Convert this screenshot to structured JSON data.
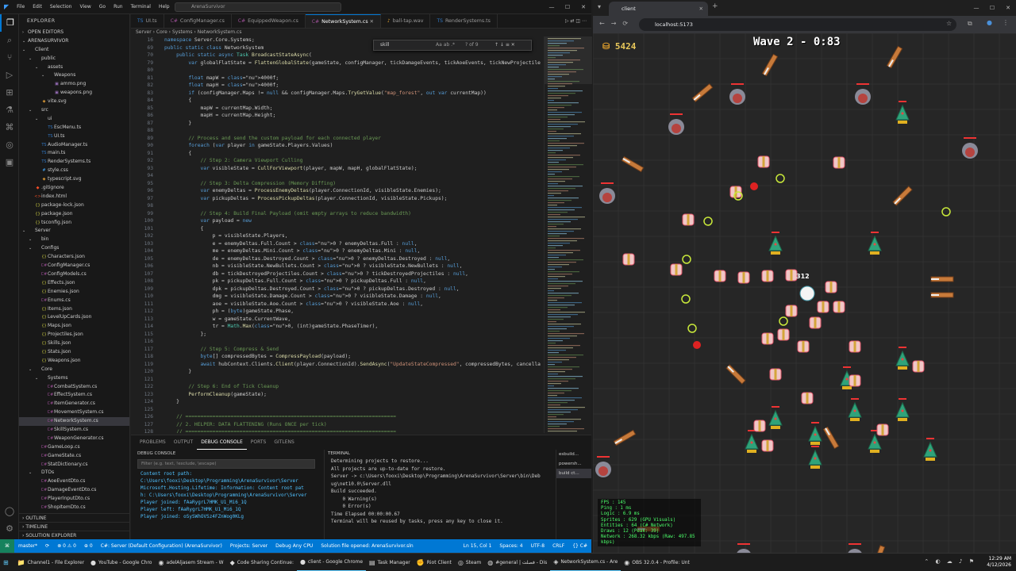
{
  "vscode": {
    "menu": [
      "File",
      "Edit",
      "Selection",
      "View",
      "Go",
      "Run",
      "Terminal",
      "Help"
    ],
    "command_center": "ArenaSurvivor",
    "explorer_title": "EXPLORER",
    "open_editors": "OPEN EDITORS",
    "workspace": "ARENASURVIVOR",
    "tree": [
      {
        "label": "Client",
        "depth": 0,
        "kind": "folder"
      },
      {
        "label": "public",
        "depth": 1,
        "kind": "folder"
      },
      {
        "label": "assets",
        "depth": 2,
        "kind": "folder"
      },
      {
        "label": "Weapons",
        "depth": 3,
        "kind": "folder"
      },
      {
        "label": "ammo.png",
        "depth": 4,
        "kind": "png"
      },
      {
        "label": "weapons.png",
        "depth": 4,
        "kind": "png"
      },
      {
        "label": "vite.svg",
        "depth": 2,
        "kind": "svg"
      },
      {
        "label": "src",
        "depth": 1,
        "kind": "folder"
      },
      {
        "label": "ui",
        "depth": 2,
        "kind": "folder"
      },
      {
        "label": "EscMenu.ts",
        "depth": 3,
        "kind": "ts"
      },
      {
        "label": "UI.ts",
        "depth": 3,
        "kind": "ts"
      },
      {
        "label": "AudioManager.ts",
        "depth": 2,
        "kind": "ts"
      },
      {
        "label": "main.ts",
        "depth": 2,
        "kind": "ts"
      },
      {
        "label": "RenderSystems.ts",
        "depth": 2,
        "kind": "ts"
      },
      {
        "label": "style.css",
        "depth": 2,
        "kind": "css"
      },
      {
        "label": "typescript.svg",
        "depth": 2,
        "kind": "svg"
      },
      {
        "label": ".gitignore",
        "depth": 1,
        "kind": "git"
      },
      {
        "label": "index.html",
        "depth": 1,
        "kind": "html"
      },
      {
        "label": "package-lock.json",
        "depth": 1,
        "kind": "json"
      },
      {
        "label": "package.json",
        "depth": 1,
        "kind": "json"
      },
      {
        "label": "tsconfig.json",
        "depth": 1,
        "kind": "json"
      },
      {
        "label": "Server",
        "depth": 0,
        "kind": "folder"
      },
      {
        "label": "bin",
        "depth": 1,
        "kind": "folder"
      },
      {
        "label": "Configs",
        "depth": 1,
        "kind": "folder"
      },
      {
        "label": "Characters.json",
        "depth": 2,
        "kind": "json"
      },
      {
        "label": "ConfigManager.cs",
        "depth": 2,
        "kind": "cs"
      },
      {
        "label": "ConfigModels.cs",
        "depth": 2,
        "kind": "cs"
      },
      {
        "label": "Effects.json",
        "depth": 2,
        "kind": "json"
      },
      {
        "label": "Enemies.json",
        "depth": 2,
        "kind": "json"
      },
      {
        "label": "Enums.cs",
        "depth": 2,
        "kind": "cs"
      },
      {
        "label": "Items.json",
        "depth": 2,
        "kind": "json"
      },
      {
        "label": "LevelUpCards.json",
        "depth": 2,
        "kind": "json"
      },
      {
        "label": "Maps.json",
        "depth": 2,
        "kind": "json"
      },
      {
        "label": "Projectiles.json",
        "depth": 2,
        "kind": "json"
      },
      {
        "label": "Skills.json",
        "depth": 2,
        "kind": "json"
      },
      {
        "label": "Stats.json",
        "depth": 2,
        "kind": "json"
      },
      {
        "label": "Weapons.json",
        "depth": 2,
        "kind": "json"
      },
      {
        "label": "Core",
        "depth": 1,
        "kind": "folder"
      },
      {
        "label": "Systems",
        "depth": 2,
        "kind": "folder"
      },
      {
        "label": "CombatSystem.cs",
        "depth": 3,
        "kind": "cs"
      },
      {
        "label": "EffectSystem.cs",
        "depth": 3,
        "kind": "cs"
      },
      {
        "label": "ItemGenerator.cs",
        "depth": 3,
        "kind": "cs"
      },
      {
        "label": "MovementSystem.cs",
        "depth": 3,
        "kind": "cs"
      },
      {
        "label": "NetworkSystem.cs",
        "depth": 3,
        "kind": "cs",
        "selected": true
      },
      {
        "label": "SkillSystem.cs",
        "depth": 3,
        "kind": "cs"
      },
      {
        "label": "WeaponGenerator.cs",
        "depth": 3,
        "kind": "cs"
      },
      {
        "label": "GameLoop.cs",
        "depth": 2,
        "kind": "cs"
      },
      {
        "label": "GameState.cs",
        "depth": 2,
        "kind": "cs"
      },
      {
        "label": "StatDictionary.cs",
        "depth": 2,
        "kind": "cs"
      },
      {
        "label": "DTOs",
        "depth": 1,
        "kind": "folder"
      },
      {
        "label": "AoeEventDto.cs",
        "depth": 2,
        "kind": "cs"
      },
      {
        "label": "DamageEventDto.cs",
        "depth": 2,
        "kind": "cs"
      },
      {
        "label": "PlayerInputDto.cs",
        "depth": 2,
        "kind": "cs"
      },
      {
        "label": "ShopItemDto.cs",
        "depth": 2,
        "kind": "cs"
      }
    ],
    "bottom_sections": [
      "OUTLINE",
      "TIMELINE",
      "SOLUTION EXPLORER"
    ],
    "tabs": [
      {
        "label": "UI.ts",
        "icon": "TS"
      },
      {
        "label": "ConfigManager.cs",
        "icon": "C#"
      },
      {
        "label": "EquippedWeapon.cs",
        "icon": "C#"
      },
      {
        "label": "NetworkSystem.cs",
        "icon": "C#",
        "active": true
      },
      {
        "label": "ball-tap.wav",
        "icon": "♪"
      },
      {
        "label": "RenderSystems.ts",
        "icon": "TS"
      }
    ],
    "breadcrumb": "Server › Core › Systems › NetworkSystem.cs",
    "find": {
      "query": "skill",
      "count": "? of 9"
    },
    "code": [
      {
        "n": "16",
        "t": "namespace Server.Core.Systems;"
      },
      {
        "n": "69",
        "t": "public static class NetworkSystem"
      },
      {
        "n": "70",
        "t": "    public static async Task BroadcastStateAsync("
      },
      {
        "n": "79",
        "t": "        var globalFlatState = FlattenGlobalState(gameState, configManager, tickDamageEvents, tickAoeEvents, tickNewProjectile"
      },
      {
        "n": "80",
        "t": ""
      },
      {
        "n": "81",
        "t": "        float mapW = 4000f;"
      },
      {
        "n": "82",
        "t": "        float mapH = 4000f;"
      },
      {
        "n": "83",
        "t": "        if (configManager.Maps != null && configManager.Maps.TryGetValue(\"map_forest\", out var currentMap))"
      },
      {
        "n": "84",
        "t": "        {"
      },
      {
        "n": "85",
        "t": "            mapW = currentMap.Width;"
      },
      {
        "n": "86",
        "t": "            mapH = currentMap.Height;"
      },
      {
        "n": "87",
        "t": "        }"
      },
      {
        "n": "88",
        "t": ""
      },
      {
        "n": "89",
        "t": "        // Process and send the custom payload for each connected player"
      },
      {
        "n": "90",
        "t": "        foreach (var player in gameState.Players.Values)"
      },
      {
        "n": "91",
        "t": "        {"
      },
      {
        "n": "92",
        "t": "            // Step 2: Camera Viewport Culling"
      },
      {
        "n": "93",
        "t": "            var visibleState = CullForViewport(player, mapW, mapH, globalFlatState);"
      },
      {
        "n": "94",
        "t": ""
      },
      {
        "n": "95",
        "t": "            // Step 3: Delta Compression (Memory Diffing)"
      },
      {
        "n": "96",
        "t": "            var enemyDeltas = ProcessEnemyDeltas(player.ConnectionId, visibleState.Enemies);"
      },
      {
        "n": "97",
        "t": "            var pickupDeltas = ProcessPickupDeltas(player.ConnectionId, visibleState.Pickups);"
      },
      {
        "n": "98",
        "t": ""
      },
      {
        "n": "99",
        "t": "            // Step 4: Build Final Payload (omit empty arrays to reduce bandwidth)"
      },
      {
        "n": "100",
        "t": "            var payload = new"
      },
      {
        "n": "101",
        "t": "            {"
      },
      {
        "n": "102",
        "t": "                p = visibleState.Players,"
      },
      {
        "n": "103",
        "t": "                e = enemyDeltas.Full.Count > 0 ? enemyDeltas.Full : null,"
      },
      {
        "n": "104",
        "t": "                me = enemyDeltas.Mini.Count > 0 ? enemyDeltas.Mini : null,"
      },
      {
        "n": "105",
        "t": "                de = enemyDeltas.Destroyed.Count > 0 ? enemyDeltas.Destroyed : null,"
      },
      {
        "n": "106",
        "t": "                nb = visibleState.NewBullets.Count > 0 ? visibleState.NewBullets : null,"
      },
      {
        "n": "107",
        "t": "                db = tickDestroyedProjectiles.Count > 0 ? tickDestroyedProjectiles : null,"
      },
      {
        "n": "108",
        "t": "                pk = pickupDeltas.Full.Count > 0 ? pickupDeltas.Full : null,"
      },
      {
        "n": "109",
        "t": "                dpk = pickupDeltas.Destroyed.Count > 0 ? pickupDeltas.Destroyed : null,"
      },
      {
        "n": "110",
        "t": "                dmg = visibleState.Damage.Count > 0 ? visibleState.Damage : null,"
      },
      {
        "n": "111",
        "t": "                aoe = visibleState.Aoe.Count > 0 ? visibleState.Aoe : null,"
      },
      {
        "n": "112",
        "t": "                ph = (byte)gameState.Phase,"
      },
      {
        "n": "113",
        "t": "                w = gameState.CurrentWave,"
      },
      {
        "n": "114",
        "t": "                tr = Math.Max(0, (int)gameState.PhaseTimer),"
      },
      {
        "n": "115",
        "t": "            };"
      },
      {
        "n": "116",
        "t": ""
      },
      {
        "n": "117",
        "t": "            // Step 5: Compress & Send"
      },
      {
        "n": "118",
        "t": "            byte[] compressedBytes = CompressPayload(payload);"
      },
      {
        "n": "119",
        "t": "            await hubContext.Clients.Client(player.ConnectionId).SendAsync(\"UpdateStateCompressed\", compressedBytes, cancella"
      },
      {
        "n": "120",
        "t": "        }"
      },
      {
        "n": "121",
        "t": ""
      },
      {
        "n": "122",
        "t": "        // Step 6: End of Tick Cleanup"
      },
      {
        "n": "123",
        "t": "        PerformCleanup(gameState);"
      },
      {
        "n": "124",
        "t": "    }"
      },
      {
        "n": "125",
        "t": ""
      },
      {
        "n": "126",
        "t": "    // ======================================================================"
      },
      {
        "n": "127",
        "t": "    // 2. HELPER: DATA FLATTENING (Runs ONCE per tick)"
      },
      {
        "n": "128",
        "t": "    // ======================================================================"
      }
    ],
    "panel_tabs": [
      "PROBLEMS",
      "OUTPUT",
      "DEBUG CONSOLE",
      "PORTS",
      "GITLENS"
    ],
    "debug_console": {
      "title": "DEBUG CONSOLE",
      "filter_placeholder": "Filter (e.g. text, !exclude, \\escape)",
      "lines": [
        "Content root path: C:\\Users\\fooxi\\Desktop\\Programming\\ArenaSurvivor\\Server",
        "Microsoft.Hosting.Lifetime: Information: Content root pat",
        "h: C:\\Users\\fooxi\\Desktop\\Programming\\ArenaSurvivor\\Server",
        "Player joined: fAaRygrL7HMK_U1_Mi6_1Q",
        "Player left: fAaRygrL7HMK_U1_Mi6_1Q",
        "Player joined: oSySWhOVSz4FZnWog0KLg"
      ]
    },
    "terminal": {
      "title": "TERMINAL",
      "lines": [
        "Determining projects to restore...",
        "All projects are up-to-date for restore.",
        "Server -> c:\\Users\\fooxi\\Desktop\\Programming\\ArenaSurvivor\\Server\\bin\\Deb",
        "ug\\net10.0\\Server.dll",
        "",
        "Build succeeded.",
        "    0 Warning(s)",
        "    0 Error(s)",
        "",
        "Time Elapsed 00:00:00.67",
        "Terminal will be reused by tasks, press any key to close it."
      ],
      "instances": [
        "esbuild...",
        "powersh...",
        "build ct..."
      ]
    },
    "status": [
      "master*",
      "⟳",
      "⊗ 0  ⚠ 0",
      "⊕ 0",
      "C#: Server (Default Configuration) (ArenaSurvivor)",
      "Projects: Server",
      "Debug Any CPU",
      "Solution file opened: ArenaSurvivor.sln",
      "Ln 15, Col 1",
      "Spaces: 4",
      "UTF-8",
      "CRLF",
      "{} C#"
    ]
  },
  "browser": {
    "tab_title": "client",
    "url": "localhost:5173",
    "game": {
      "gold": "5424",
      "wave": "Wave 2 - 0:83",
      "player_tag": "312",
      "stats": [
        "FPS      : 145",
        "Ping     : 1 ms",
        "Logic    : 6.9 ms",
        "Sprites  : 629 (GPU Visuals)",
        "Entities : 64 (C# Network)",
        "Draws    : 12 (Peak: 39)",
        "Network  : 268.32 kbps (Raw: 497.85 kbps)"
      ]
    }
  },
  "taskbar": {
    "items": [
      {
        "label": "Channel1 - File Explorer",
        "icon": "📁"
      },
      {
        "label": "YouTube - Google Chro",
        "icon": "●"
      },
      {
        "label": "adelAljasem Stream - W",
        "icon": "◉"
      },
      {
        "label": "Code Sharing Continue:",
        "icon": "◆"
      },
      {
        "label": "client - Google Chrome",
        "icon": "●",
        "active": true
      },
      {
        "label": "Task Manager",
        "icon": "▤"
      },
      {
        "label": "Riot Client",
        "icon": "✊"
      },
      {
        "label": "Steam",
        "icon": "◎"
      },
      {
        "label": "#general | فصلت - Dis",
        "icon": "◍"
      },
      {
        "label": "NetworkSystem.cs - Are",
        "icon": "◈",
        "active": true
      },
      {
        "label": "OBS 32.0.4 - Profile: Unt",
        "icon": "◉"
      }
    ],
    "time": "12:29 AM",
    "date": "4/12/2026"
  }
}
